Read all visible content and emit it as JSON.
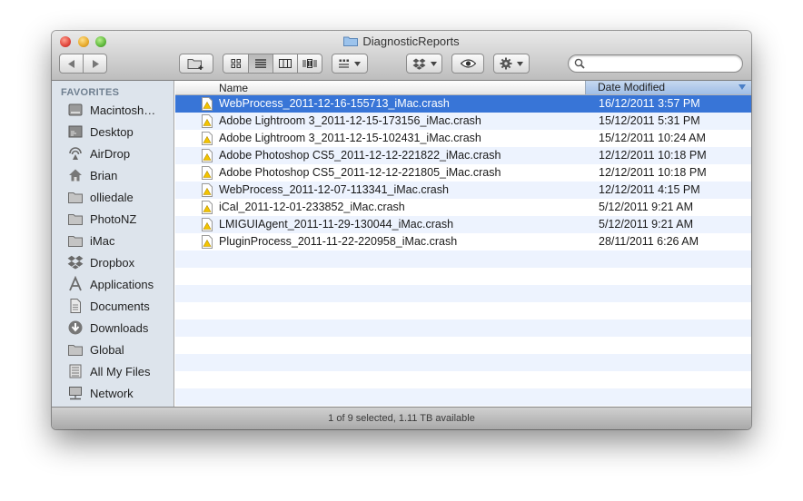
{
  "window": {
    "title": "DiagnosticReports"
  },
  "toolbar": {
    "back_icon": "triangle-left-icon",
    "forward_icon": "triangle-right-icon",
    "new_folder_icon": "new-folder-icon",
    "view_modes": [
      "icon-view",
      "list-view",
      "column-view",
      "cover-flow-view"
    ],
    "active_view": "list-view",
    "arrange_icon": "arrange-icon",
    "dropbox_icon": "dropbox-icon",
    "quicklook_icon": "eye-icon",
    "action_icon": "gear-icon",
    "search": {
      "value": "",
      "placeholder": ""
    }
  },
  "sidebar": {
    "header": "FAVORITES",
    "items": [
      {
        "label": "Macintosh…",
        "icon": "hard-drive-icon"
      },
      {
        "label": "Desktop",
        "icon": "desktop-icon"
      },
      {
        "label": "AirDrop",
        "icon": "airdrop-icon"
      },
      {
        "label": "Brian",
        "icon": "home-icon"
      },
      {
        "label": "olliedale",
        "icon": "folder-icon"
      },
      {
        "label": "PhotoNZ",
        "icon": "folder-icon"
      },
      {
        "label": "iMac",
        "icon": "folder-icon"
      },
      {
        "label": "Dropbox",
        "icon": "dropbox-icon"
      },
      {
        "label": "Applications",
        "icon": "applications-icon"
      },
      {
        "label": "Documents",
        "icon": "documents-icon"
      },
      {
        "label": "Downloads",
        "icon": "downloads-icon"
      },
      {
        "label": "Global",
        "icon": "folder-icon"
      },
      {
        "label": "All My Files",
        "icon": "all-files-icon"
      },
      {
        "label": "Network",
        "icon": "network-icon"
      }
    ]
  },
  "list": {
    "columns": {
      "name": "Name",
      "date": "Date Modified"
    },
    "rows": [
      {
        "name": "WebProcess_2011-12-16-155713_iMac.crash",
        "date": "16/12/2011 3:57 PM",
        "selected": true
      },
      {
        "name": "Adobe Lightroom 3_2011-12-15-173156_iMac.crash",
        "date": "15/12/2011 5:31 PM"
      },
      {
        "name": "Adobe Lightroom 3_2011-12-15-102431_iMac.crash",
        "date": "15/12/2011 10:24 AM"
      },
      {
        "name": "Adobe Photoshop CS5_2011-12-12-221822_iMac.crash",
        "date": "12/12/2011 10:18 PM"
      },
      {
        "name": "Adobe Photoshop CS5_2011-12-12-221805_iMac.crash",
        "date": "12/12/2011 10:18 PM"
      },
      {
        "name": "WebProcess_2011-12-07-113341_iMac.crash",
        "date": "12/12/2011 4:15 PM"
      },
      {
        "name": "iCal_2011-12-01-233852_iMac.crash",
        "date": "5/12/2011 9:21 AM"
      },
      {
        "name": "LMIGUIAgent_2011-11-29-130044_iMac.crash",
        "date": "5/12/2011 9:21 AM"
      },
      {
        "name": "PluginProcess_2011-11-22-220958_iMac.crash",
        "date": "28/11/2011 6:26 AM"
      }
    ]
  },
  "status": {
    "text": "1 of 9 selected, 1.11 TB available"
  },
  "colors": {
    "selection": "#3875d7",
    "alt_row": "#edf3fe",
    "sidebar_bg": "#dde4ec"
  }
}
